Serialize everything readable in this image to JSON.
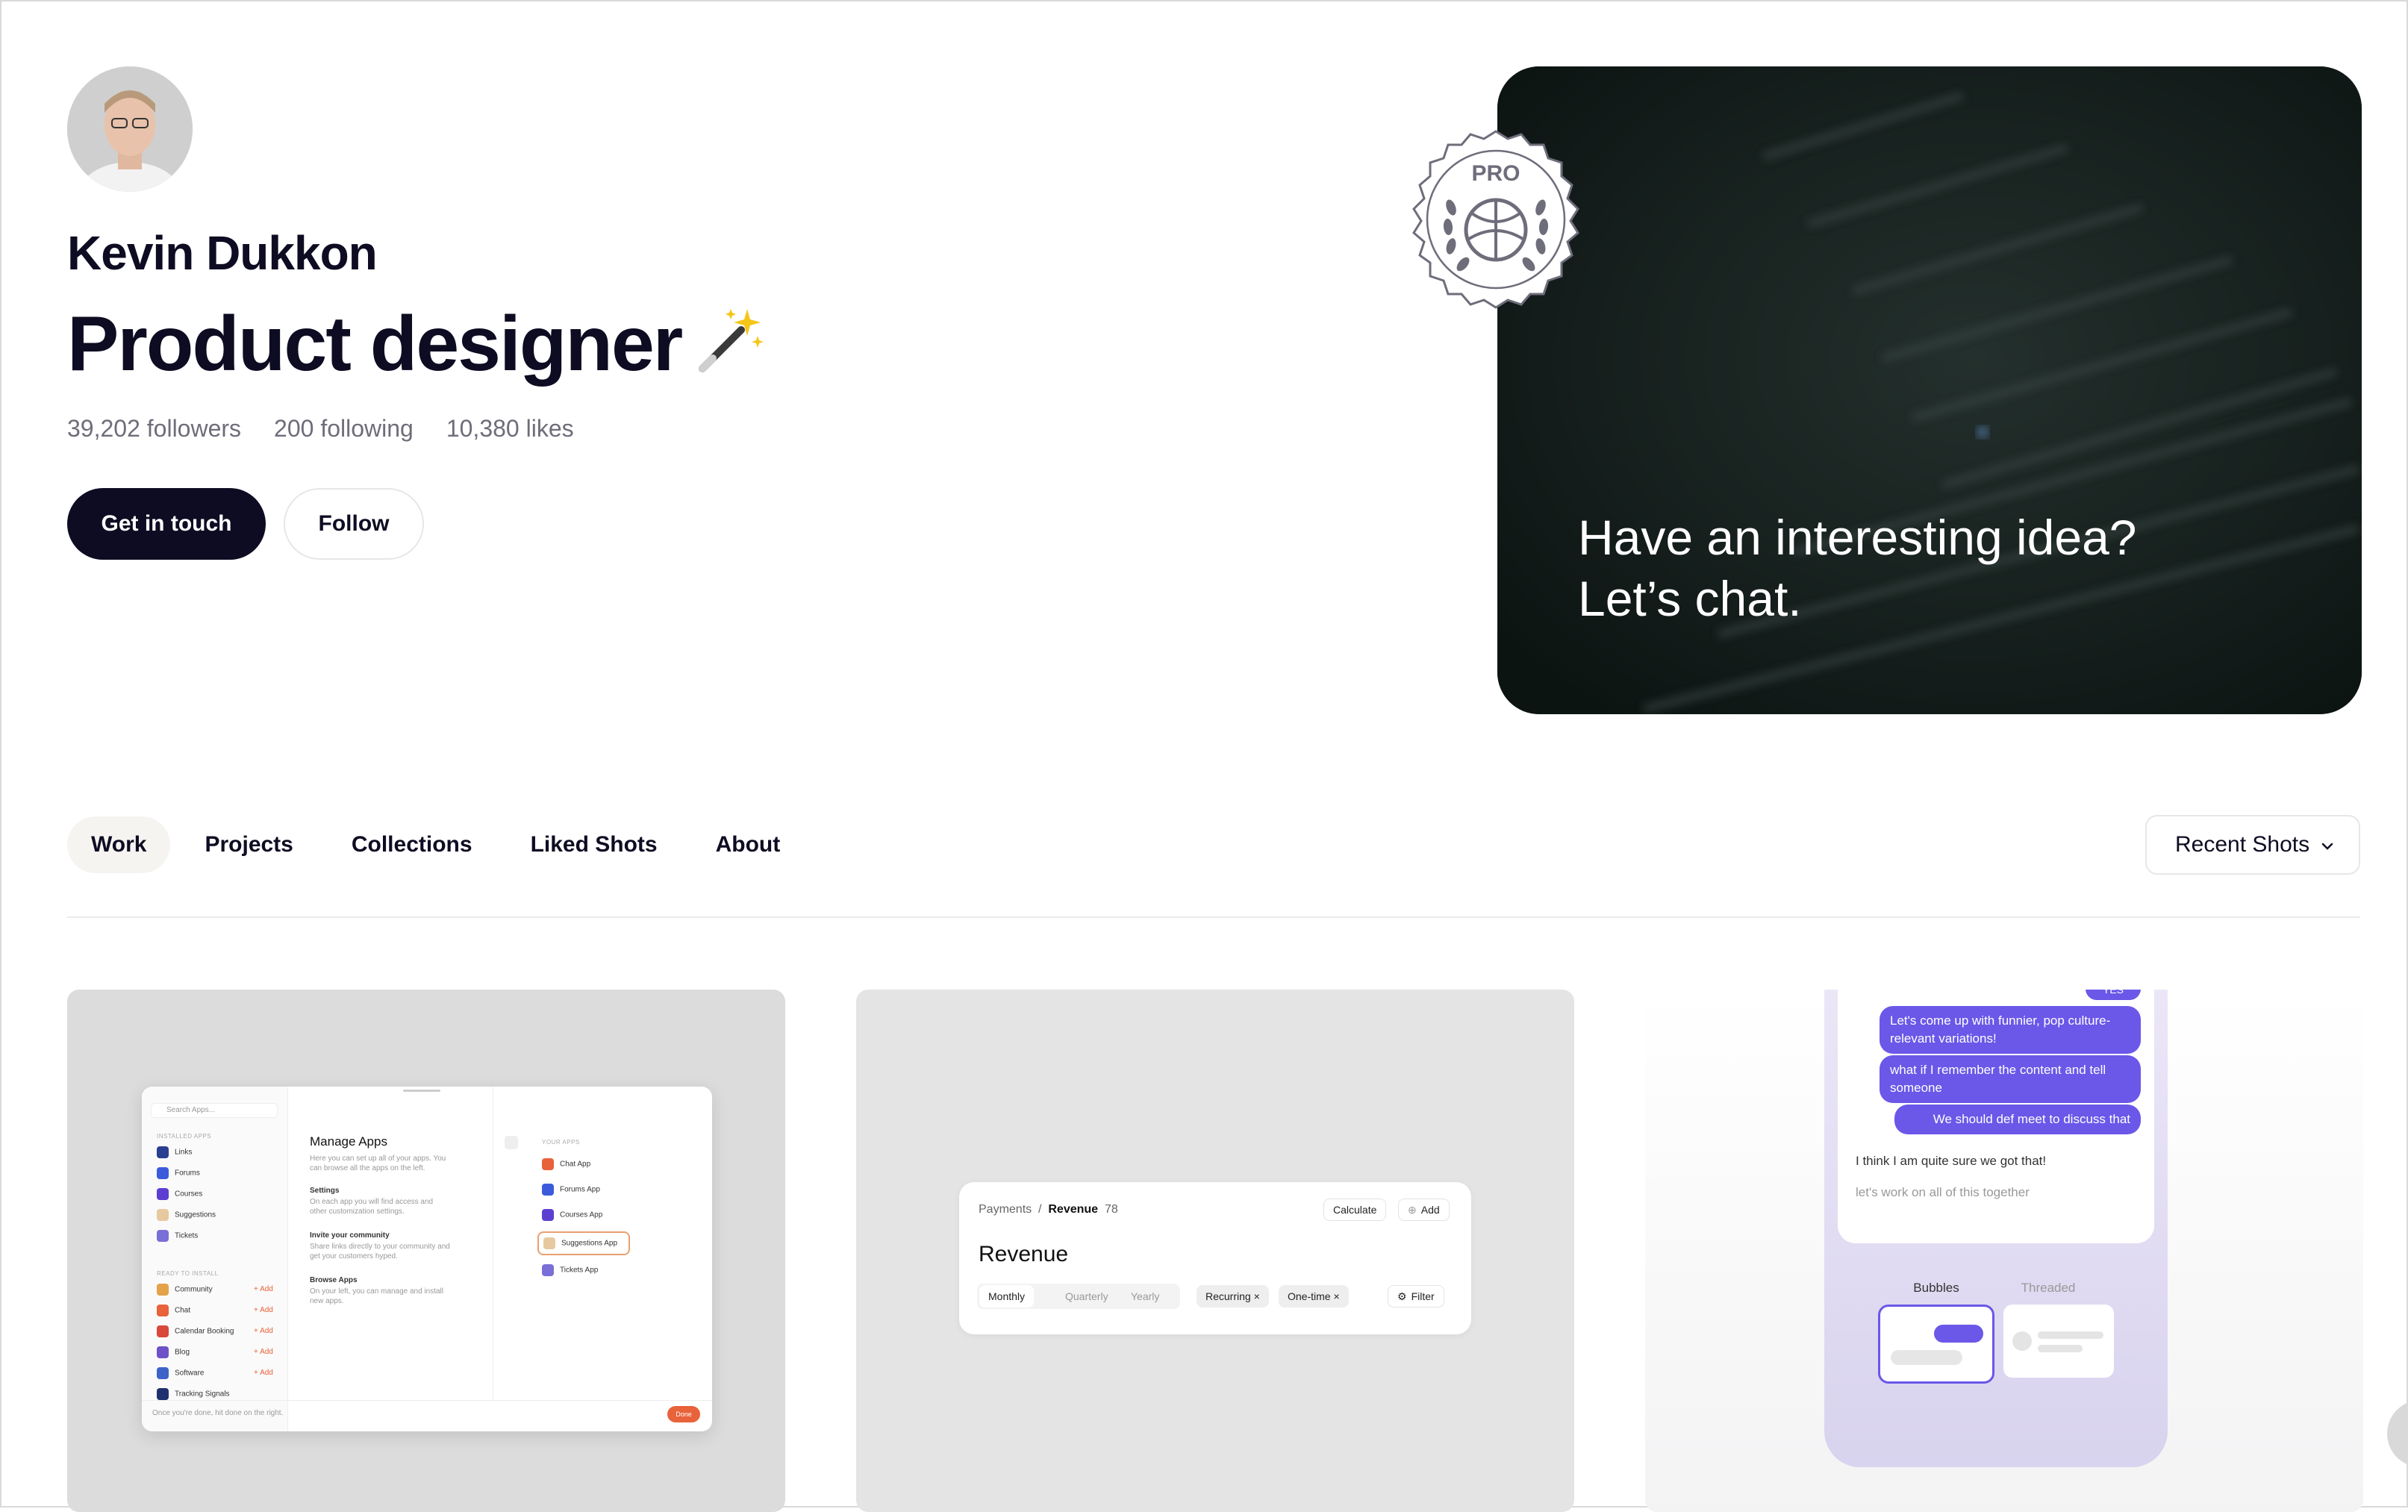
{
  "profile": {
    "name": "Kevin Dukkon",
    "headline": "Product designer",
    "stats": {
      "followers": "39,202 followers",
      "following": "200 following",
      "likes": "10,380 likes"
    },
    "get_in_touch": "Get in touch",
    "follow": "Follow"
  },
  "promo": {
    "line1": "Have an interesting idea?",
    "line2": "Let’s chat.",
    "badge": "PRO"
  },
  "tabs": [
    {
      "label": "Work",
      "active": true
    },
    {
      "label": "Projects"
    },
    {
      "label": "Collections"
    },
    {
      "label": "Liked Shots"
    },
    {
      "label": "About"
    }
  ],
  "sort": {
    "label": "Recent Shots"
  },
  "shots": {
    "shot1": {
      "search": "Search Apps...",
      "installed_header": "INSTALLED APPS",
      "installed": [
        "Links",
        "Forums",
        "Courses",
        "Suggestions",
        "Tickets"
      ],
      "ready_header": "READY TO INSTALL",
      "ready": [
        "Community",
        "Chat",
        "Calendar Booking",
        "Blog",
        "Software",
        "Tracking Signals"
      ],
      "add": "+ Add",
      "title": "Manage Apps",
      "intro": "Here you can set up all of your apps. You can browse all the apps on the left.",
      "sections": [
        {
          "h": "Settings",
          "t": "On each app you will find access and other customization settings."
        },
        {
          "h": "Invite your community",
          "t": "Share links directly to your community and get your customers hyped."
        },
        {
          "h": "Browse Apps",
          "t": "On your left, you can manage and install new apps."
        }
      ],
      "your_apps_header": "YOUR APPS",
      "your_apps": [
        "Chat App",
        "Forums App",
        "Courses App",
        "Suggestions App",
        "Tickets App"
      ],
      "footer": "Once you're done, hit done on the right.",
      "done": "Done"
    },
    "shot2": {
      "crumb1": "Payments",
      "sep": "/",
      "crumb2": "Revenue",
      "count": "78",
      "calculate": "Calculate",
      "add": "Add",
      "title": "Revenue",
      "periods": [
        "Monthly",
        "Quarterly",
        "Yearly"
      ],
      "filters": [
        "Recurring ×",
        "One-time ×"
      ],
      "filter": "Filter"
    },
    "shot3": {
      "top_chip": "YES",
      "sent": [
        "Let's come up with funnier, pop culture-relevant variations!",
        "what if I remember the content and tell someone",
        "We should def meet  to discuss that"
      ],
      "received": [
        "I think I am quite sure we got that!",
        "let's work on all of this together"
      ],
      "tab_bubbles": "Bubbles",
      "tab_threaded": "Threaded"
    }
  },
  "colors": {
    "primary": "#0d0c22",
    "muted": "#6e6d7a",
    "accent": "#6b57e8",
    "promo_bg": "#101a18"
  }
}
